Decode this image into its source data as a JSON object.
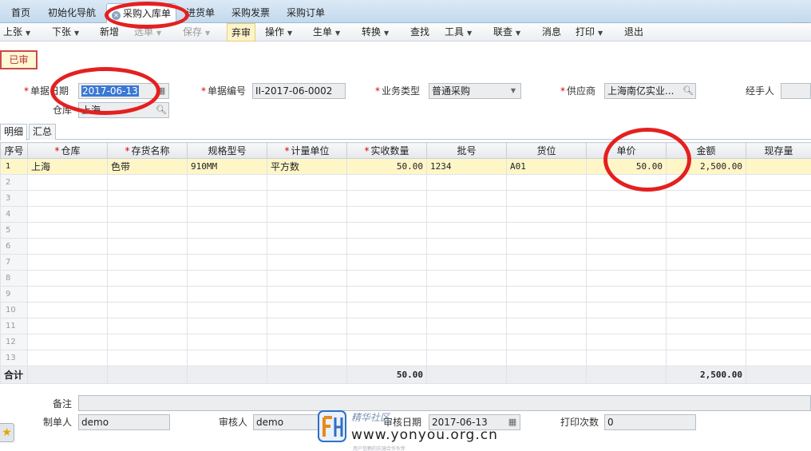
{
  "tabs": [
    {
      "label": "首页"
    },
    {
      "label": "初始化导航"
    },
    {
      "label": "采购入库单",
      "active": true
    },
    {
      "label": "进货单"
    },
    {
      "label": "采购发票"
    },
    {
      "label": "采购订单"
    }
  ],
  "toolbar": {
    "prev": "上张",
    "next": "下张",
    "new": "新增",
    "select": "选单",
    "save": "保存",
    "unaudit": "弃审",
    "operate": "操作",
    "generate": "生单",
    "convert": "转换",
    "find": "查找",
    "tools": "工具",
    "linked": "联查",
    "message": "消息",
    "print": "打印",
    "exit": "退出"
  },
  "status_badge": "已审",
  "form": {
    "doc_date_label": "单据日期",
    "doc_date_value": "2017-06-13",
    "doc_no_label": "单据编号",
    "doc_no_value": "II-2017-06-0002",
    "biz_type_label": "业务类型",
    "biz_type_value": "普通采购",
    "supplier_label": "供应商",
    "supplier_value": "上海南亿实业...",
    "handler_label": "经手人",
    "handler_value": "",
    "warehouse_label": "仓库",
    "warehouse_value": "上海"
  },
  "subtabs": {
    "detail": "明细",
    "summary": "汇总"
  },
  "grid": {
    "headers": {
      "seq": "序号",
      "warehouse": "仓库",
      "item": "存货名称",
      "spec": "规格型号",
      "unit": "计量单位",
      "qty": "实收数量",
      "batch": "批号",
      "location": "货位",
      "price": "单价",
      "amount": "金额",
      "stock": "现存量"
    },
    "rows": [
      {
        "seq": "1",
        "warehouse": "上海",
        "item": "色带",
        "spec": "910MM",
        "unit": "平方数",
        "qty": "50.00",
        "batch": "1234",
        "location": "A01",
        "price": "50.00",
        "amount": "2,500.00",
        "stock": ""
      },
      {
        "seq": "2"
      },
      {
        "seq": "3"
      },
      {
        "seq": "4"
      },
      {
        "seq": "5"
      },
      {
        "seq": "6"
      },
      {
        "seq": "7"
      },
      {
        "seq": "8"
      },
      {
        "seq": "9"
      },
      {
        "seq": "10"
      },
      {
        "seq": "11"
      },
      {
        "seq": "12"
      },
      {
        "seq": "13"
      }
    ],
    "total": {
      "label": "合计",
      "qty": "50.00",
      "amount": "2,500.00"
    }
  },
  "footer": {
    "remark_label": "备注",
    "remark_value": "",
    "creator_label": "制单人",
    "creator_value": "demo",
    "auditor_label": "审核人",
    "auditor_value": "demo",
    "audit_date_label": "审核日期",
    "audit_date_value": "2017-06-13",
    "print_count_label": "打印次数",
    "print_count_value": "0"
  },
  "watermark": {
    "tagline": "精华社区",
    "url": "www.yonyou.org.cn",
    "sub": "用户信赖的实施合作伙伴"
  },
  "colors": {
    "accent": "#3a78d4",
    "annotation": "#e42020",
    "highlight_row": "#fff6c8"
  }
}
